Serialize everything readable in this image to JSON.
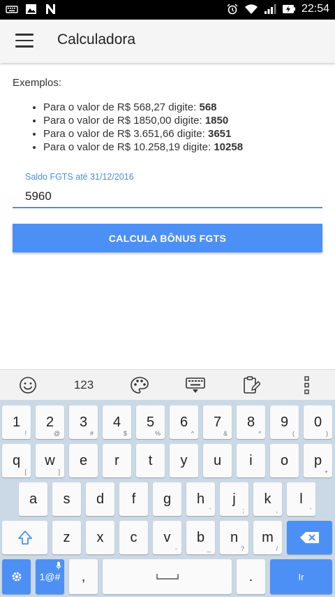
{
  "status_bar": {
    "time": "22:54"
  },
  "app_bar": {
    "title": "Calculadora"
  },
  "content": {
    "examples_title": "Exemplos:",
    "examples": [
      {
        "text": "Para o valor de R$ 568,27 digite: ",
        "bold": "568"
      },
      {
        "text": "Para o valor de R$ 1850,00 digite: ",
        "bold": "1850"
      },
      {
        "text": "Para o valor de R$ 3.651,66 digite: ",
        "bold": "3651"
      },
      {
        "text": "Para o valor de R$ 10.258,19 digite: ",
        "bold": "10258"
      }
    ],
    "field_label": "Saldo FGTS até 31/12/2016",
    "field_value": "5960",
    "button_label": "CALCULA BÔNUS FGTS"
  },
  "keyboard_toolbar": {
    "numbers_label": "123"
  },
  "keyboard": {
    "row1": [
      {
        "k": "1",
        "s": "!"
      },
      {
        "k": "2",
        "s": "@"
      },
      {
        "k": "3",
        "s": "#"
      },
      {
        "k": "4",
        "s": "$"
      },
      {
        "k": "5",
        "s": "%"
      },
      {
        "k": "6",
        "s": "^"
      },
      {
        "k": "7",
        "s": "&"
      },
      {
        "k": "8",
        "s": "*"
      },
      {
        "k": "9",
        "s": "("
      },
      {
        "k": "0",
        "s": ")"
      }
    ],
    "row2": [
      {
        "k": "q",
        "s": "["
      },
      {
        "k": "w",
        "s": "]"
      },
      {
        "k": "e",
        "s": ""
      },
      {
        "k": "r",
        "s": ""
      },
      {
        "k": "t",
        "s": ""
      },
      {
        "k": "y",
        "s": ""
      },
      {
        "k": "u",
        "s": ""
      },
      {
        "k": "i",
        "s": ""
      },
      {
        "k": "o",
        "s": ""
      },
      {
        "k": "p",
        "s": "+"
      }
    ],
    "row3": [
      {
        "k": "a",
        "s": ""
      },
      {
        "k": "s",
        "s": ""
      },
      {
        "k": "d",
        "s": ""
      },
      {
        "k": "f",
        "s": ""
      },
      {
        "k": "g",
        "s": ""
      },
      {
        "k": "h",
        "s": "'"
      },
      {
        "k": "j",
        "s": ";"
      },
      {
        "k": "k",
        "s": ","
      },
      {
        "k": "l",
        "s": "'"
      }
    ],
    "row4": [
      {
        "k": "z",
        "s": ""
      },
      {
        "k": "x",
        "s": ""
      },
      {
        "k": "c",
        "s": ""
      },
      {
        "k": "v",
        "s": "-"
      },
      {
        "k": "b",
        "s": "_"
      },
      {
        "k": "n",
        "s": "?"
      },
      {
        "k": "m",
        "s": "/"
      }
    ],
    "symbols_label": "1@#",
    "comma_label": ",",
    "period_label": ".",
    "action_label": "Ir",
    "accent_color": "#4d90f5"
  }
}
